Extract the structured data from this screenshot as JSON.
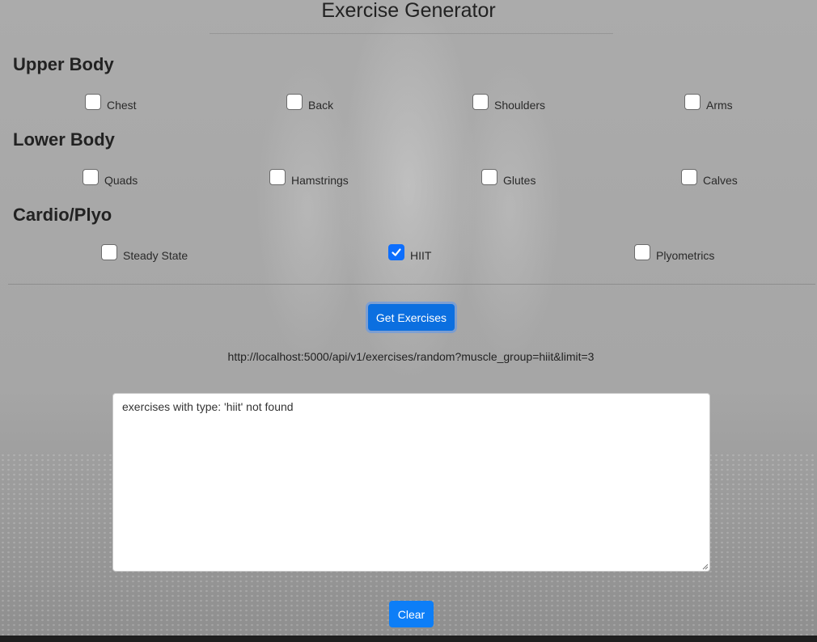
{
  "page": {
    "title": "Exercise Generator"
  },
  "sections": {
    "upper_body": {
      "heading": "Upper Body",
      "options": [
        {
          "label": "Chest",
          "checked": false
        },
        {
          "label": "Back",
          "checked": false
        },
        {
          "label": "Shoulders",
          "checked": false
        },
        {
          "label": "Arms",
          "checked": false
        }
      ]
    },
    "lower_body": {
      "heading": "Lower Body",
      "options": [
        {
          "label": "Quads",
          "checked": false
        },
        {
          "label": "Hamstrings",
          "checked": false
        },
        {
          "label": "Glutes",
          "checked": false
        },
        {
          "label": "Calves",
          "checked": false
        }
      ]
    },
    "cardio": {
      "heading": "Cardio/Plyo",
      "options": [
        {
          "label": "Steady State",
          "checked": false
        },
        {
          "label": "HIIT",
          "checked": true
        },
        {
          "label": "Plyometrics",
          "checked": false
        }
      ]
    }
  },
  "actions": {
    "get_label": "Get Exercises",
    "clear_label": "Clear"
  },
  "request_url": "http://localhost:5000/api/v1/exercises/random?muscle_group=hiit&limit=3",
  "result_text": "exercises with type: 'hiit' not found",
  "colors": {
    "accent": "#0d6efd",
    "button_get": "#0b6fe0",
    "button_clear": "#0d7ef7"
  }
}
